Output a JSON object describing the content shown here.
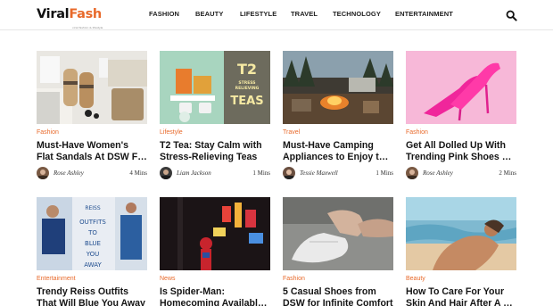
{
  "site": {
    "logo_part1": "Viral",
    "logo_part2": "Fash",
    "logo_tagline": "viral fashion & lifestyle"
  },
  "nav": {
    "items": [
      "FASHION",
      "BEAUTY",
      "LIFESTYLE",
      "TRAVEL",
      "TECHNOLOGY",
      "ENTERTAINMENT"
    ]
  },
  "search": {
    "icon": "search-icon"
  },
  "articles": [
    {
      "category": "Fashion",
      "title_line1": "Must-Have Women's",
      "title_line2": "Flat Sandals At DSW Fo...",
      "author": "Rose Ashley",
      "read_time": "4 Mins",
      "thumb_text": ""
    },
    {
      "category": "Lifestyle",
      "title_line1": "T2 Tea: Stay Calm with",
      "title_line2": "Stress-Relieving Teas",
      "author": "Liam Jackson",
      "read_time": "1 Mins",
      "thumb_text": "T2 STRESS RELIEVING TEAS"
    },
    {
      "category": "Travel",
      "title_line1": "Must-Have Camping",
      "title_line2": "Appliances to Enjoy the...",
      "author": "Tessie Maxwell",
      "read_time": "1 Mins",
      "thumb_text": ""
    },
    {
      "category": "Fashion",
      "title_line1": "Get All Dolled Up With",
      "title_line2": "Trending Pink Shoes at...",
      "author": "Rose Ashley",
      "read_time": "2 Mins",
      "thumb_text": ""
    },
    {
      "category": "Entertainment",
      "title_line1": "Trendy Reiss Outfits",
      "title_line2": "That Will Blue You Away",
      "author": "",
      "read_time": "",
      "thumb_text": "REISS OUTFITS TO BLUE YOU AWAY"
    },
    {
      "category": "News",
      "title_line1": "Is Spider-Man:",
      "title_line2": "Homecoming Available...",
      "author": "",
      "read_time": "",
      "thumb_text": ""
    },
    {
      "category": "Fashion",
      "title_line1": "5 Casual Shoes from",
      "title_line2": "DSW for Infinite Comfort",
      "author": "",
      "read_time": "",
      "thumb_text": ""
    },
    {
      "category": "Beauty",
      "title_line1": "How To Care For Your",
      "title_line2": "Skin And Hair After A D...",
      "author": "",
      "read_time": "",
      "thumb_text": ""
    }
  ],
  "colors": {
    "accent": "#e8692a",
    "text": "#151515"
  }
}
